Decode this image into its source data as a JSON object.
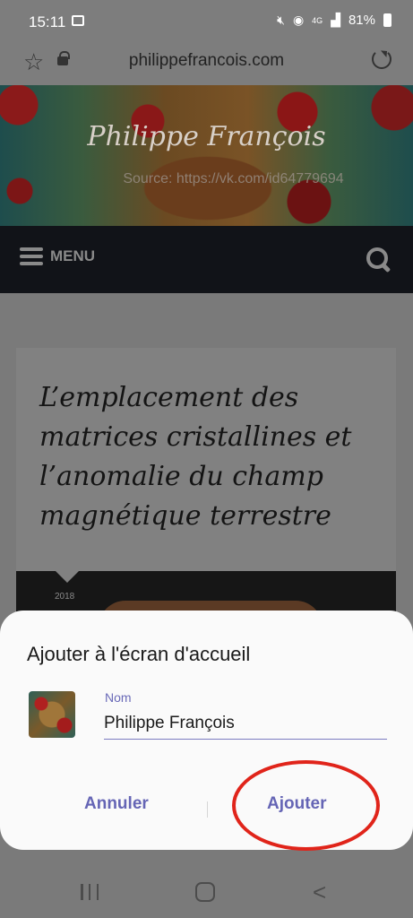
{
  "status_bar": {
    "time": "15:11",
    "network": "4G",
    "battery": "81%"
  },
  "browser": {
    "url": "philippefrancois.com"
  },
  "site": {
    "title": "Philippe François",
    "source_watermark": "Source: https://vk.com/id64779694",
    "menu_label": "MENU"
  },
  "article": {
    "title": "L’emplacement des matrices cristallines et l’anomalie du champ magnétique terrestre",
    "year": "2018"
  },
  "dialog": {
    "title": "Ajouter à l'écran d'accueil",
    "field_label": "Nom",
    "field_value": "Philippe François",
    "cancel_label": "Annuler",
    "add_label": "Ajouter"
  },
  "colors": {
    "accent": "#6565b5",
    "highlight": "#e0241a",
    "nav_bg": "#111318"
  },
  "icons": [
    "image-icon",
    "mute-icon",
    "hotspot-icon",
    "signal-icon",
    "battery-icon",
    "star-icon",
    "lock-icon",
    "reload-icon",
    "hamburger-icon",
    "search-icon",
    "recent-apps-icon",
    "home-icon",
    "back-icon"
  ]
}
